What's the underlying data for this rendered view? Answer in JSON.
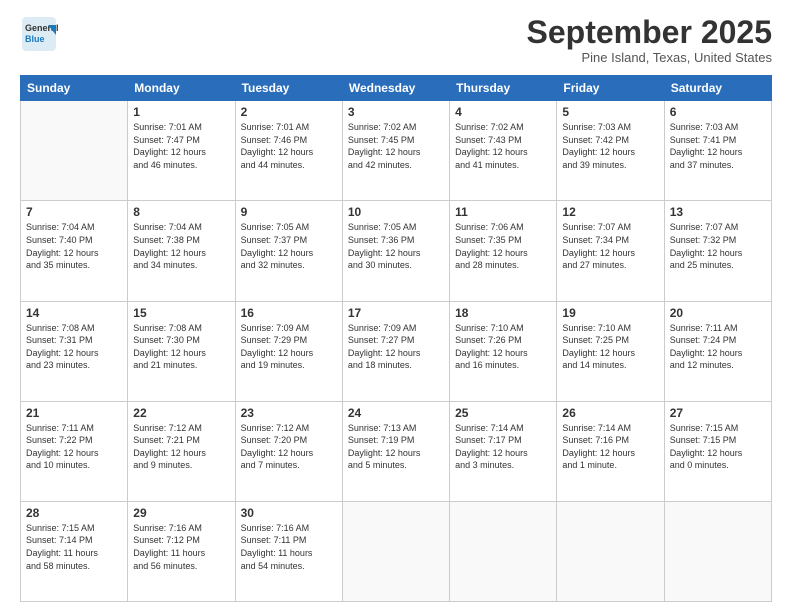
{
  "header": {
    "logo_general": "General",
    "logo_blue": "Blue",
    "month": "September 2025",
    "location": "Pine Island, Texas, United States"
  },
  "weekdays": [
    "Sunday",
    "Monday",
    "Tuesday",
    "Wednesday",
    "Thursday",
    "Friday",
    "Saturday"
  ],
  "weeks": [
    [
      {
        "day": "",
        "info": ""
      },
      {
        "day": "1",
        "info": "Sunrise: 7:01 AM\nSunset: 7:47 PM\nDaylight: 12 hours\nand 46 minutes."
      },
      {
        "day": "2",
        "info": "Sunrise: 7:01 AM\nSunset: 7:46 PM\nDaylight: 12 hours\nand 44 minutes."
      },
      {
        "day": "3",
        "info": "Sunrise: 7:02 AM\nSunset: 7:45 PM\nDaylight: 12 hours\nand 42 minutes."
      },
      {
        "day": "4",
        "info": "Sunrise: 7:02 AM\nSunset: 7:43 PM\nDaylight: 12 hours\nand 41 minutes."
      },
      {
        "day": "5",
        "info": "Sunrise: 7:03 AM\nSunset: 7:42 PM\nDaylight: 12 hours\nand 39 minutes."
      },
      {
        "day": "6",
        "info": "Sunrise: 7:03 AM\nSunset: 7:41 PM\nDaylight: 12 hours\nand 37 minutes."
      }
    ],
    [
      {
        "day": "7",
        "info": "Sunrise: 7:04 AM\nSunset: 7:40 PM\nDaylight: 12 hours\nand 35 minutes."
      },
      {
        "day": "8",
        "info": "Sunrise: 7:04 AM\nSunset: 7:38 PM\nDaylight: 12 hours\nand 34 minutes."
      },
      {
        "day": "9",
        "info": "Sunrise: 7:05 AM\nSunset: 7:37 PM\nDaylight: 12 hours\nand 32 minutes."
      },
      {
        "day": "10",
        "info": "Sunrise: 7:05 AM\nSunset: 7:36 PM\nDaylight: 12 hours\nand 30 minutes."
      },
      {
        "day": "11",
        "info": "Sunrise: 7:06 AM\nSunset: 7:35 PM\nDaylight: 12 hours\nand 28 minutes."
      },
      {
        "day": "12",
        "info": "Sunrise: 7:07 AM\nSunset: 7:34 PM\nDaylight: 12 hours\nand 27 minutes."
      },
      {
        "day": "13",
        "info": "Sunrise: 7:07 AM\nSunset: 7:32 PM\nDaylight: 12 hours\nand 25 minutes."
      }
    ],
    [
      {
        "day": "14",
        "info": "Sunrise: 7:08 AM\nSunset: 7:31 PM\nDaylight: 12 hours\nand 23 minutes."
      },
      {
        "day": "15",
        "info": "Sunrise: 7:08 AM\nSunset: 7:30 PM\nDaylight: 12 hours\nand 21 minutes."
      },
      {
        "day": "16",
        "info": "Sunrise: 7:09 AM\nSunset: 7:29 PM\nDaylight: 12 hours\nand 19 minutes."
      },
      {
        "day": "17",
        "info": "Sunrise: 7:09 AM\nSunset: 7:27 PM\nDaylight: 12 hours\nand 18 minutes."
      },
      {
        "day": "18",
        "info": "Sunrise: 7:10 AM\nSunset: 7:26 PM\nDaylight: 12 hours\nand 16 minutes."
      },
      {
        "day": "19",
        "info": "Sunrise: 7:10 AM\nSunset: 7:25 PM\nDaylight: 12 hours\nand 14 minutes."
      },
      {
        "day": "20",
        "info": "Sunrise: 7:11 AM\nSunset: 7:24 PM\nDaylight: 12 hours\nand 12 minutes."
      }
    ],
    [
      {
        "day": "21",
        "info": "Sunrise: 7:11 AM\nSunset: 7:22 PM\nDaylight: 12 hours\nand 10 minutes."
      },
      {
        "day": "22",
        "info": "Sunrise: 7:12 AM\nSunset: 7:21 PM\nDaylight: 12 hours\nand 9 minutes."
      },
      {
        "day": "23",
        "info": "Sunrise: 7:12 AM\nSunset: 7:20 PM\nDaylight: 12 hours\nand 7 minutes."
      },
      {
        "day": "24",
        "info": "Sunrise: 7:13 AM\nSunset: 7:19 PM\nDaylight: 12 hours\nand 5 minutes."
      },
      {
        "day": "25",
        "info": "Sunrise: 7:14 AM\nSunset: 7:17 PM\nDaylight: 12 hours\nand 3 minutes."
      },
      {
        "day": "26",
        "info": "Sunrise: 7:14 AM\nSunset: 7:16 PM\nDaylight: 12 hours\nand 1 minute."
      },
      {
        "day": "27",
        "info": "Sunrise: 7:15 AM\nSunset: 7:15 PM\nDaylight: 12 hours\nand 0 minutes."
      }
    ],
    [
      {
        "day": "28",
        "info": "Sunrise: 7:15 AM\nSunset: 7:14 PM\nDaylight: 11 hours\nand 58 minutes."
      },
      {
        "day": "29",
        "info": "Sunrise: 7:16 AM\nSunset: 7:12 PM\nDaylight: 11 hours\nand 56 minutes."
      },
      {
        "day": "30",
        "info": "Sunrise: 7:16 AM\nSunset: 7:11 PM\nDaylight: 11 hours\nand 54 minutes."
      },
      {
        "day": "",
        "info": ""
      },
      {
        "day": "",
        "info": ""
      },
      {
        "day": "",
        "info": ""
      },
      {
        "day": "",
        "info": ""
      }
    ]
  ]
}
